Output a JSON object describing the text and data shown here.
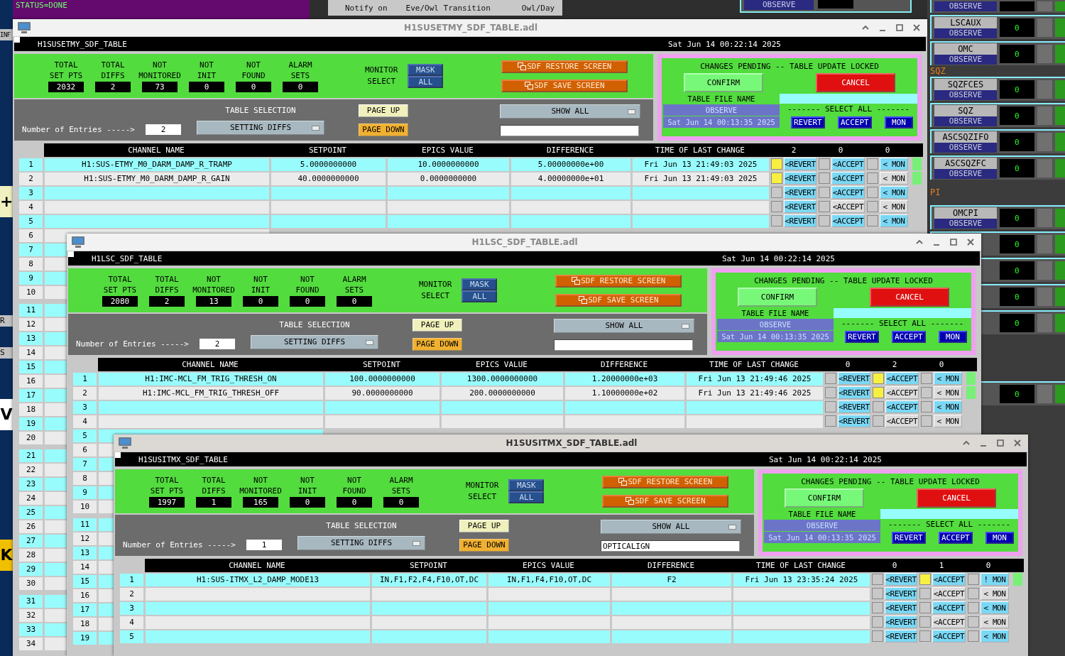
{
  "desktop": {
    "status_text": "STATUS=DONE",
    "notify_panel": [
      "Notify on",
      "Eve/Owl Transition",
      "Owl/Day"
    ],
    "left_labels": [
      {
        "kind": "button",
        "text": "INF"
      },
      {
        "kind": "big",
        "text": "+"
      },
      {
        "kind": "button",
        "text": "R"
      },
      {
        "kind": "button",
        "text": "S"
      },
      {
        "kind": "big",
        "text": "V"
      },
      {
        "kind": "bigyellow",
        "text": "K"
      }
    ],
    "middle_tile": {
      "state": "OBSERVE"
    },
    "side_panel": [
      {
        "kind": "tile",
        "state": "OBSERVE"
      },
      {
        "kind": "tile",
        "name": "LSCAUX",
        "state": "OBSERVE",
        "reading": "0"
      },
      {
        "kind": "tile",
        "name": "OMC",
        "state": "OBSERVE",
        "reading": "0"
      },
      {
        "kind": "heading",
        "text": "SQZ"
      },
      {
        "kind": "tile",
        "name": "SQZFCES",
        "state": "OBSERVE",
        "reading": "0"
      },
      {
        "kind": "tile",
        "name": "SQZ",
        "state": "OBSERVE",
        "reading": "0"
      },
      {
        "kind": "tile",
        "name": "ASCSQZIFO",
        "state": "OBSERVE",
        "reading": "0"
      },
      {
        "kind": "tile",
        "name": "ASCSQZFC",
        "state": "OBSERVE",
        "reading": "0"
      },
      {
        "kind": "heading",
        "text": "PI"
      },
      {
        "kind": "tile",
        "name": "OMCPI",
        "state": "OBSERVE",
        "reading": "0"
      },
      {
        "kind": "tile",
        "reading": "0"
      },
      {
        "kind": "tile",
        "reading": "0"
      },
      {
        "kind": "tile",
        "reading": "0"
      },
      {
        "kind": "tile",
        "reading": "0"
      },
      {
        "kind": "gap"
      },
      {
        "kind": "tile",
        "reading": "0"
      }
    ]
  },
  "windows": [
    {
      "title": "H1SUSETMY_SDF_TABLE.adl",
      "active": false,
      "screen_name": "H1SUSETMY_SDF_TABLE",
      "datetime": "Sat Jun 14 00:22:14 2025",
      "stats": [
        {
          "label": "TOTAL SET PTS",
          "value": "2032"
        },
        {
          "label": "TOTAL DIFFS",
          "value": "2"
        },
        {
          "label": "NOT MONITORED",
          "value": "73"
        },
        {
          "label": "NOT INIT",
          "value": "0"
        },
        {
          "label": "NOT FOUND",
          "value": "0"
        },
        {
          "label": "ALARM SETS",
          "value": "0"
        }
      ],
      "monitor_select": {
        "label": "MONITOR SELECT",
        "buttons": [
          "MASK",
          "ALL"
        ]
      },
      "restore_button": "SDF RESTORE SCREEN",
      "save_button": "SDF SAVE SCREEN",
      "entries": {
        "label": "Number of Entries ----->",
        "value": "2"
      },
      "table_selection": {
        "label": "TABLE SELECTION",
        "value": "SETTING DIFFS"
      },
      "page_up": "PAGE UP",
      "page_down": "PAGE DOWN",
      "show_all": "SHOW ALL",
      "pending": {
        "message": "CHANGES PENDING -- TABLE UPDATE LOCKED",
        "confirm": "CONFIRM",
        "cancel": "CANCEL",
        "file_label": "TABLE FILE NAME",
        "file_name": "OBSERVE",
        "file_date": "Sat Jun 14 00:13:35 2025",
        "select_all": "------- SELECT ALL -------",
        "buttons": [
          "REVERT",
          "ACCEPT",
          "MON"
        ]
      },
      "columns": [
        "CHANNEL NAME",
        "SETPOINT",
        "EPICS VALUE",
        "DIFFERENCE",
        "TIME OF LAST CHANGE"
      ],
      "counts": [
        "2",
        "0",
        "0"
      ],
      "rows": [
        {
          "index": "1",
          "channel": "H1:SUS-ETMY_M0_DARM_DAMP_R_TRAMP",
          "setpoint": "5.0000000000",
          "epics_value": "10.0000000000",
          "difference": "5.00000000e+00",
          "time": "Fri Jun 13 21:49:03 2025",
          "status_on": true,
          "actions": [
            {
              "label": "<REVERT",
              "checked": true,
              "lit": true
            },
            {
              "label": "<ACCEPT",
              "checked": false,
              "lit": true
            },
            {
              "label": "< MON",
              "checked": false,
              "lit": true
            }
          ]
        },
        {
          "index": "2",
          "channel": "H1:SUS-ETMY_M0_DARM_DAMP_R_GAIN",
          "setpoint": "40.0000000000",
          "epics_value": "0.0000000000",
          "difference": "4.00000000e+01",
          "time": "Fri Jun 13 21:49:03 2025",
          "status_on": true,
          "actions": [
            {
              "label": "<REVERT",
              "checked": true,
              "lit": true
            },
            {
              "label": "<ACCEPT",
              "checked": false,
              "lit": true
            },
            {
              "label": "< MON",
              "checked": false,
              "lit": false
            }
          ]
        },
        {
          "index": "3",
          "status_on": false,
          "actions": [
            {
              "label": "<REVERT",
              "checked": false,
              "lit": true
            },
            {
              "label": "<ACCEPT",
              "checked": false,
              "lit": true
            },
            {
              "label": "< MON",
              "checked": false,
              "lit": true
            }
          ]
        },
        {
          "index": "4",
          "status_on": false,
          "actions": [
            {
              "label": "<REVERT",
              "checked": false,
              "lit": true
            },
            {
              "label": "<ACCEPT",
              "checked": false,
              "lit": false
            },
            {
              "label": "< MON",
              "checked": false,
              "lit": false
            }
          ]
        },
        {
          "index": "5",
          "status_on": false,
          "actions": [
            {
              "label": "<REVERT",
              "checked": false,
              "lit": true
            },
            {
              "label": "<ACCEPT",
              "checked": false,
              "lit": true
            },
            {
              "label": "< MON",
              "checked": false,
              "lit": true
            }
          ]
        },
        {
          "index": "6"
        },
        {
          "index": "7"
        },
        {
          "index": "8"
        },
        {
          "index": "9"
        },
        {
          "index": "10"
        },
        {
          "index": "11"
        },
        {
          "index": "12"
        },
        {
          "index": "13"
        },
        {
          "index": "14"
        },
        {
          "index": "15"
        },
        {
          "index": "16"
        },
        {
          "index": "17"
        },
        {
          "index": "18"
        },
        {
          "index": "19"
        },
        {
          "index": "20"
        },
        {
          "index": "21"
        },
        {
          "index": "22"
        },
        {
          "index": "23"
        },
        {
          "index": "24"
        },
        {
          "index": "25"
        },
        {
          "index": "26"
        },
        {
          "index": "27"
        },
        {
          "index": "28"
        },
        {
          "index": "29"
        },
        {
          "index": "30"
        },
        {
          "index": "31"
        },
        {
          "index": "32"
        },
        {
          "index": "33"
        },
        {
          "index": "34"
        }
      ]
    },
    {
      "title": "H1LSC_SDF_TABLE.adl",
      "active": false,
      "screen_name": "H1LSC_SDF_TABLE",
      "datetime": "Sat Jun 14 00:22:14 2025",
      "stats": [
        {
          "label": "TOTAL SET PTS",
          "value": "2080"
        },
        {
          "label": "TOTAL DIFFS",
          "value": "2"
        },
        {
          "label": "NOT MONITORED",
          "value": "13"
        },
        {
          "label": "NOT INIT",
          "value": "0"
        },
        {
          "label": "NOT FOUND",
          "value": "0"
        },
        {
          "label": "ALARM SETS",
          "value": "0"
        }
      ],
      "monitor_select": {
        "label": "MONITOR SELECT",
        "buttons": [
          "MASK",
          "ALL"
        ]
      },
      "restore_button": "SDF RESTORE SCREEN",
      "save_button": "SDF SAVE SCREEN",
      "entries": {
        "label": "Number of Entries ----->",
        "value": "2"
      },
      "table_selection": {
        "label": "TABLE SELECTION",
        "value": "SETTING DIFFS"
      },
      "page_up": "PAGE UP",
      "page_down": "PAGE DOWN",
      "show_all": "SHOW ALL",
      "pending": {
        "message": "CHANGES PENDING -- TABLE UPDATE LOCKED",
        "confirm": "CONFIRM",
        "cancel": "CANCEL",
        "file_label": "TABLE FILE NAME",
        "file_name": "OBSERVE",
        "file_date": "Sat Jun 14 00:13:35 2025",
        "select_all": "------- SELECT ALL -------",
        "buttons": [
          "REVERT",
          "ACCEPT",
          "MON"
        ]
      },
      "columns": [
        "CHANNEL NAME",
        "SETPOINT",
        "EPICS VALUE",
        "DIFFERENCE",
        "TIME OF LAST CHANGE"
      ],
      "counts": [
        "0",
        "2",
        "0"
      ],
      "rows": [
        {
          "index": "1",
          "channel": "H1:IMC-MCL_FM_TRIG_THRESH_ON",
          "setpoint": "100.0000000000",
          "epics_value": "1300.0000000000",
          "difference": "1.20000000e+03",
          "time": "Fri Jun 13 21:49:46 2025",
          "status_on": true,
          "actions": [
            {
              "label": "<REVERT",
              "checked": false,
              "lit": true
            },
            {
              "label": "<ACCEPT",
              "checked": true,
              "lit": true
            },
            {
              "label": "< MON",
              "checked": false,
              "lit": true
            }
          ]
        },
        {
          "index": "2",
          "channel": "H1:IMC-MCL_FM_TRIG_THRESH_OFF",
          "setpoint": "90.0000000000",
          "epics_value": "200.0000000000",
          "difference": "1.10000000e+02",
          "time": "Fri Jun 13 21:49:46 2025",
          "status_on": true,
          "actions": [
            {
              "label": "<REVERT",
              "checked": false,
              "lit": true
            },
            {
              "label": "<ACCEPT",
              "checked": true,
              "lit": false
            },
            {
              "label": "< MON",
              "checked": false,
              "lit": false
            }
          ]
        },
        {
          "index": "3",
          "status_on": false,
          "actions": [
            {
              "label": "<REVERT",
              "checked": false,
              "lit": true
            },
            {
              "label": "<ACCEPT",
              "checked": false,
              "lit": true
            },
            {
              "label": "< MON",
              "checked": false,
              "lit": true
            }
          ]
        },
        {
          "index": "4",
          "status_on": false,
          "actions": [
            {
              "label": "<REVERT",
              "checked": false,
              "lit": true
            },
            {
              "label": "<ACCEPT",
              "checked": false,
              "lit": false
            },
            {
              "label": "< MON",
              "checked": false,
              "lit": false
            }
          ]
        },
        {
          "index": "5"
        },
        {
          "index": "6"
        },
        {
          "index": "7"
        },
        {
          "index": "8"
        },
        {
          "index": "9"
        },
        {
          "index": "10"
        },
        {
          "index": "11"
        },
        {
          "index": "12"
        },
        {
          "index": "13"
        },
        {
          "index": "14"
        },
        {
          "index": "15"
        },
        {
          "index": "16"
        },
        {
          "index": "17"
        },
        {
          "index": "18"
        },
        {
          "index": "19"
        }
      ]
    },
    {
      "title": "H1SUSITMX_SDF_TABLE.adl",
      "active": true,
      "screen_name": "H1SUSITMX_SDF_TABLE",
      "datetime": "Sat Jun 14 00:22:14 2025",
      "stats": [
        {
          "label": "TOTAL SET PTS",
          "value": "1997"
        },
        {
          "label": "TOTAL DIFFS",
          "value": "1"
        },
        {
          "label": "NOT MONITORED",
          "value": "165"
        },
        {
          "label": "NOT INIT",
          "value": "0"
        },
        {
          "label": "NOT FOUND",
          "value": "0"
        },
        {
          "label": "ALARM SETS",
          "value": "0"
        }
      ],
      "monitor_select": {
        "label": "MONITOR SELECT",
        "buttons": [
          "MASK",
          "ALL"
        ]
      },
      "restore_button": "SDF RESTORE SCREEN",
      "save_button": "SDF SAVE SCREEN",
      "entries": {
        "label": "Number of Entries ----->",
        "value": "1"
      },
      "table_selection": {
        "label": "TABLE SELECTION",
        "value": "SETTING DIFFS"
      },
      "page_up": "PAGE UP",
      "page_down": "PAGE DOWN",
      "show_all": "SHOW ALL",
      "filter_value": "OPTICALIGN",
      "pending": {
        "message": "CHANGES PENDING -- TABLE UPDATE LOCKED",
        "confirm": "CONFIRM",
        "cancel": "CANCEL",
        "file_label": "TABLE FILE NAME",
        "file_name": "OBSERVE",
        "file_date": "Sat Jun 14 00:13:35 2025",
        "select_all": "------- SELECT ALL -------",
        "buttons": [
          "REVERT",
          "ACCEPT",
          "MON"
        ]
      },
      "columns": [
        "CHANNEL NAME",
        "SETPOINT",
        "EPICS VALUE",
        "DIFFERENCE",
        "TIME OF LAST CHANGE"
      ],
      "counts": [
        "0",
        "1",
        "0"
      ],
      "rows": [
        {
          "index": "1",
          "channel": "H1:SUS-ITMX_L2_DAMP_MODE13",
          "setpoint": "IN,F1,F2,F4,F10,OT,DC",
          "epics_value": "IN,F1,F4,F10,OT,DC",
          "difference": "F2",
          "time": "Fri Jun 13 23:35:24 2025",
          "status_on": true,
          "actions": [
            {
              "label": "<REVERT",
              "checked": false,
              "lit": true
            },
            {
              "label": "<ACCEPT",
              "checked": true,
              "lit": true
            },
            {
              "label": "! MON",
              "checked": false,
              "lit": true
            }
          ]
        },
        {
          "index": "2",
          "status_on": false,
          "actions": [
            {
              "label": "<REVERT",
              "checked": false,
              "lit": true
            },
            {
              "label": "<ACCEPT",
              "checked": false,
              "lit": false
            },
            {
              "label": "< MON",
              "checked": false,
              "lit": false
            }
          ]
        },
        {
          "index": "3",
          "status_on": false,
          "actions": [
            {
              "label": "<REVERT",
              "checked": false,
              "lit": true
            },
            {
              "label": "<ACCEPT",
              "checked": false,
              "lit": true
            },
            {
              "label": "< MON",
              "checked": false,
              "lit": true
            }
          ]
        },
        {
          "index": "4",
          "status_on": false,
          "actions": [
            {
              "label": "<REVERT",
              "checked": false,
              "lit": true
            },
            {
              "label": "<ACCEPT",
              "checked": false,
              "lit": false
            },
            {
              "label": "< MON",
              "checked": false,
              "lit": false
            }
          ]
        },
        {
          "index": "5",
          "status_on": false,
          "actions": [
            {
              "label": "<REVERT",
              "checked": false,
              "lit": true
            },
            {
              "label": "<ACCEPT",
              "checked": false,
              "lit": true
            },
            {
              "label": "< MON",
              "checked": false,
              "lit": true
            }
          ]
        }
      ]
    }
  ]
}
